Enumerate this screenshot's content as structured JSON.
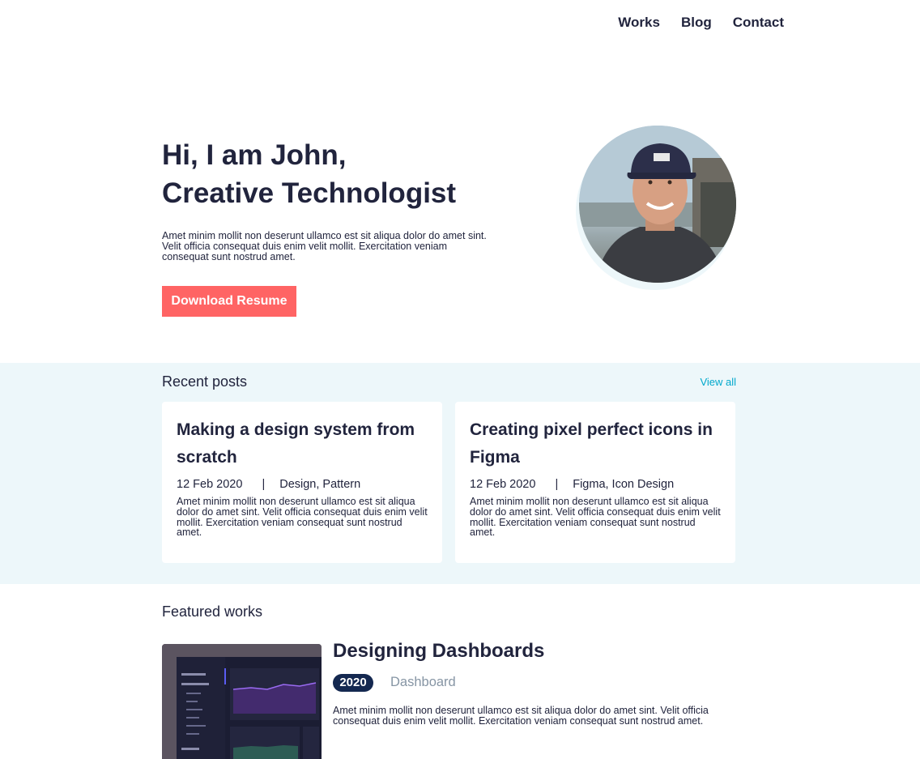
{
  "nav": {
    "items": [
      "Works",
      "Blog",
      "Contact"
    ]
  },
  "hero": {
    "title_line1": "Hi, I am John,",
    "title_line2": "Creative Technologist",
    "description": "Amet minim mollit non deserunt ullamco est sit aliqua dolor do amet sint. Velit officia consequat duis enim velit mollit. Exercitation veniam consequat sunt nostrud amet.",
    "button_label": "Download Resume"
  },
  "posts": {
    "heading": "Recent posts",
    "view_all": "View all",
    "items": [
      {
        "title": "Making a design system from scratch",
        "date": "12 Feb 2020",
        "separator": "|",
        "tags": "Design, Pattern",
        "description": "Amet minim mollit non deserunt ullamco est sit aliqua dolor do amet sint. Velit officia consequat duis enim velit mollit. Exercitation veniam consequat sunt nostrud amet."
      },
      {
        "title": "Creating pixel perfect icons in Figma",
        "date": "12 Feb 2020",
        "separator": "|",
        "tags": "Figma, Icon Design",
        "description": "Amet minim mollit non deserunt ullamco est sit aliqua dolor do amet sint. Velit officia consequat duis enim velit mollit. Exercitation veniam consequat sunt nostrud amet."
      }
    ]
  },
  "works": {
    "heading": "Featured works",
    "items": [
      {
        "title": "Designing Dashboards",
        "year": "2020",
        "category": "Dashboard",
        "description": "Amet minim mollit non deserunt ullamco est sit aliqua dolor do amet sint. Velit officia consequat duis enim velit mollit. Exercitation veniam consequat sunt nostrud amet."
      }
    ]
  },
  "colors": {
    "accent": "#ff6464",
    "link": "#00a8cc",
    "text": "#21243d",
    "section_bg": "#edf7fa",
    "badge_bg": "#142850",
    "muted": "#8695a4"
  }
}
